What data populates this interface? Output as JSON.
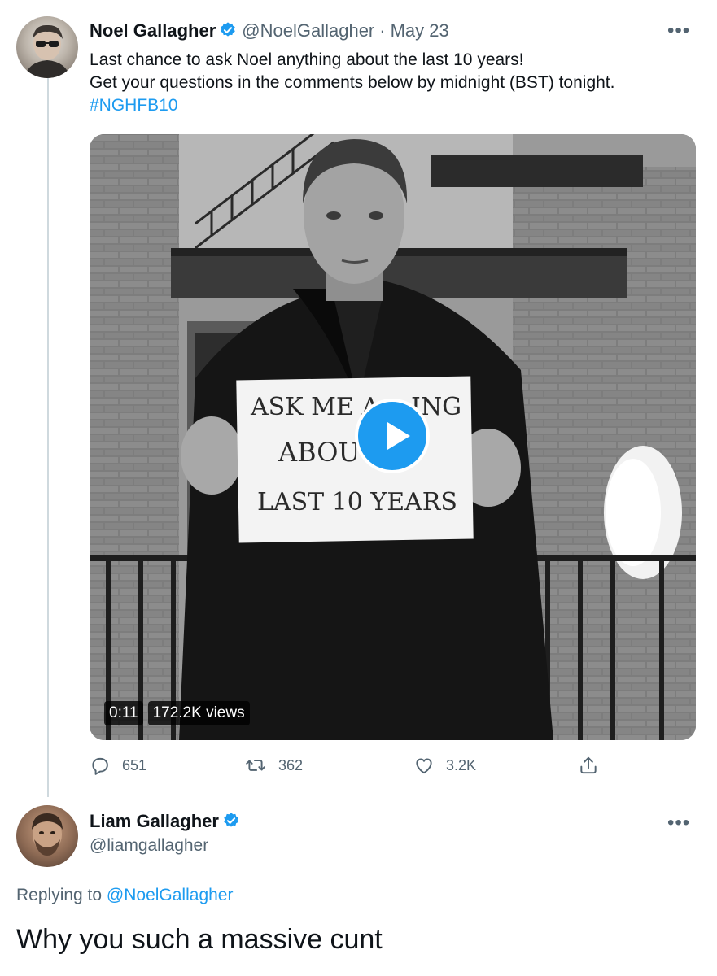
{
  "tweet": {
    "author_name": "Noel Gallagher",
    "author_handle": "@NoelGallagher",
    "separator": "·",
    "date": "May 23",
    "text_line1": "Last chance to ask Noel anything about the last 10 years!",
    "text_line2": "Get your questions in the comments below by midnight (BST) tonight.",
    "hashtag": "#NGHFB10",
    "media": {
      "sign_line1": "ASK ME A",
      "sign_line1b": "ING",
      "sign_line2": "ABOU",
      "sign_line3": "LAST 10 YEARS",
      "duration": "0:11",
      "views": "172.2K views"
    },
    "stats": {
      "replies": "651",
      "retweets": "362",
      "likes": "3.2K"
    }
  },
  "reply": {
    "author_name": "Liam Gallagher",
    "author_handle": "@liamgallagher",
    "replying_prefix": "Replying to ",
    "replying_to": "@NoelGallagher",
    "text": "Why you such a massive cunt"
  },
  "colors": {
    "accent": "#1d9bf0",
    "muted": "#536471",
    "text": "#0f1419"
  }
}
